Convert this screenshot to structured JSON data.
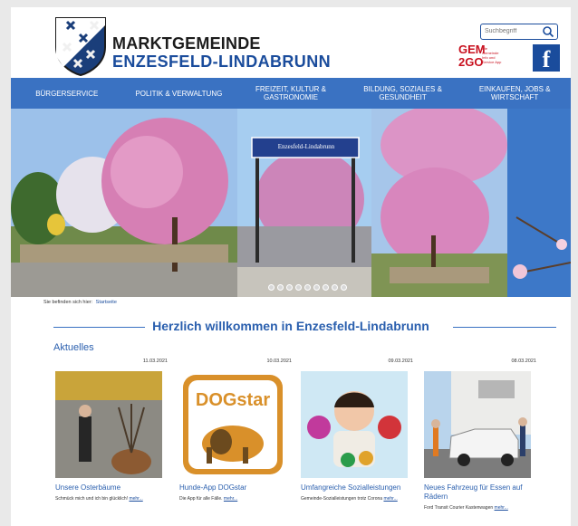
{
  "header": {
    "brand_top": "MARKTGEMEINDE",
    "brand_bottom": "ENZESFELD-LINDABRUNN",
    "search_placeholder": "Suchbegriff",
    "gem_big_1": "GEM",
    "gem_big_2": "2GO",
    "gem_small": "Die Gemeinde Info und Service App",
    "facebook_label": "f"
  },
  "nav": {
    "items": [
      {
        "label": "BÜRGERSERVICE"
      },
      {
        "label": "POLITIK & VERWALTUNG"
      },
      {
        "label": "FREIZEIT, KULTUR & GASTRONOMIE"
      },
      {
        "label": "BILDUNG, SOZIALES & GESUNDHEIT"
      },
      {
        "label": "EINKAUFEN, JOBS & WIRTSCHAFT"
      }
    ]
  },
  "banner": {
    "sign_text": "Enzesfeld-Lindabrunn",
    "slide_count": 9
  },
  "breadcrumb": {
    "prefix": "Sie befinden sich hier:",
    "link": "Startseite"
  },
  "main": {
    "welcome": "Herzlich willkommen in Enzesfeld-Lindabrunn",
    "section_title": "Aktuelles",
    "news": [
      {
        "date": "11.03.2021",
        "title": "Unsere Osterbäume",
        "text": "Schmück mich und ich bin glücklich!",
        "more": "mehr..."
      },
      {
        "date": "10.03.2021",
        "title": "Hunde-App DOGstar",
        "text": "Die App für alle Fälle.",
        "more": "mehr..."
      },
      {
        "date": "09.03.2021",
        "title": "Umfangreiche Sozialleistungen",
        "text": "Gemeinde-Sozialleistungen trotz Corona",
        "more": "mehr..."
      },
      {
        "date": "08.03.2021",
        "title": "Neues Fahrzeug für Essen auf Rädern",
        "text": "Ford Transit Courier Kastenwagen",
        "more": "mehr..."
      }
    ]
  },
  "colors": {
    "brand_blue": "#1a4c9c",
    "nav_blue": "#3a72c2",
    "gem_red": "#c8101e"
  }
}
